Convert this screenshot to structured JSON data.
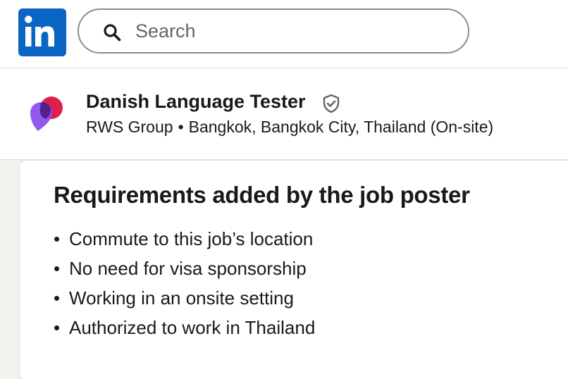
{
  "header": {
    "logo_icon": "linkedin-logo-icon",
    "search": {
      "placeholder": "Search",
      "icon": "search-icon"
    }
  },
  "job": {
    "company_logo": "rws-logo-icon",
    "title": "Danish Language Tester",
    "verified_icon": "verified-shield-icon",
    "company": "RWS Group",
    "separator": "•",
    "location": "Bangkok, Bangkok City, Thailand (On-site)"
  },
  "requirements": {
    "title": "Requirements added by the job poster",
    "bullet": "•",
    "items": [
      "Commute to this job’s location",
      "No need for visa sponsorship",
      "Working in an onsite setting",
      "Authorized to work in Thailand"
    ]
  },
  "colors": {
    "brand": "#0a66c2",
    "page_background": "#f4f2ee",
    "logo_red": "#e0204a",
    "logo_purple": "#8a4cf0"
  }
}
